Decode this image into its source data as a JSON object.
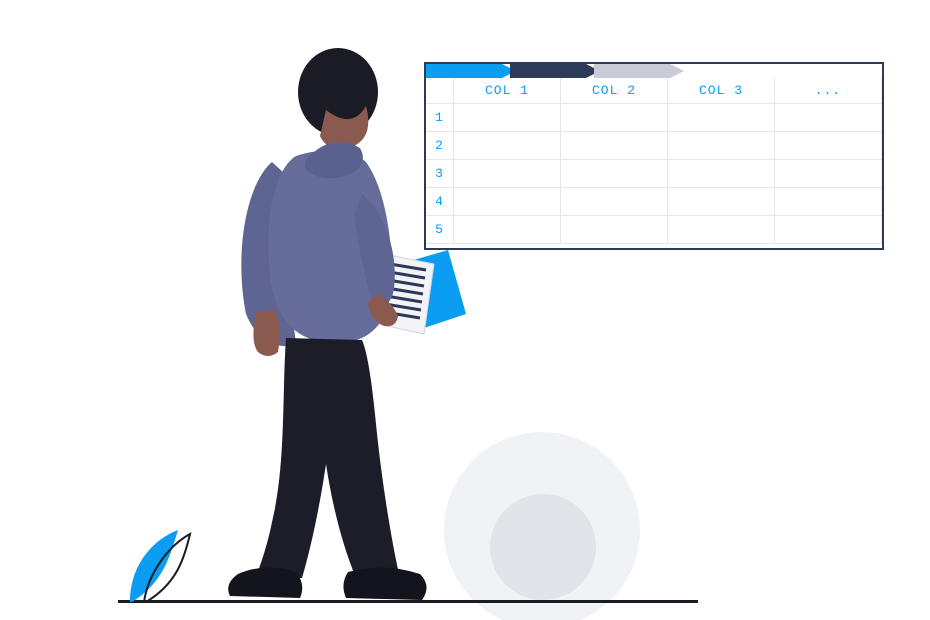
{
  "spreadsheet": {
    "headers": [
      "COL 1",
      "COL 2",
      "COL 3",
      "..."
    ],
    "rows": [
      "1",
      "2",
      "3",
      "4",
      "5"
    ]
  },
  "tabs": {
    "count": 3
  },
  "colors": {
    "accent": "#0A9DF2",
    "dark": "#2E3A59",
    "muted": "#C9CBD6"
  }
}
